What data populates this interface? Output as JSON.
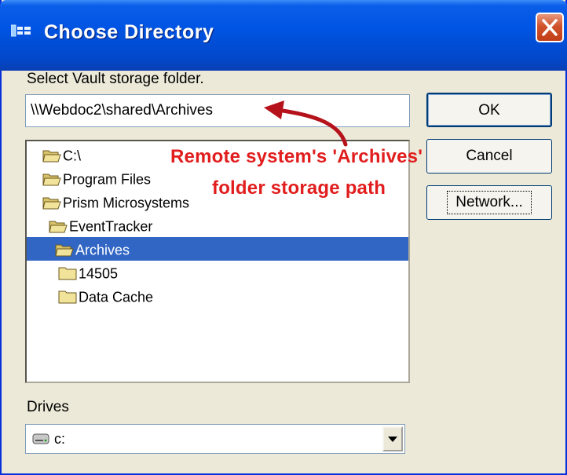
{
  "window": {
    "title": "Choose Directory",
    "title_icon": "folder-tree-icon",
    "close_icon": "close-x-icon"
  },
  "form": {
    "prompt_label": "Select Vault storage folder.",
    "path_value": "\\\\Webdoc2\\shared\\Archives",
    "drives_label": "Drives",
    "drive_value": "c:",
    "drive_icon": "hard-drive-icon"
  },
  "buttons": {
    "ok": "OK",
    "cancel": "Cancel",
    "network": "Network..."
  },
  "tree": {
    "items": [
      {
        "label": "C:\\",
        "state": "open"
      },
      {
        "label": "Program Files",
        "state": "open"
      },
      {
        "label": "Prism Microsystems",
        "state": "open"
      },
      {
        "label": "EventTracker",
        "state": "open"
      },
      {
        "label": "Archives",
        "state": "open",
        "selected": true
      },
      {
        "label": "14505",
        "state": "closed"
      },
      {
        "label": "Data Cache",
        "state": "closed"
      }
    ]
  },
  "annotation": {
    "line1": "Remote system's  'Archives'",
    "line2": "folder storage path",
    "color": "#e11d1d"
  },
  "colors": {
    "title_bar": "#0054e3",
    "dialog_bg": "#ece9d8",
    "selection": "#3166c5"
  }
}
